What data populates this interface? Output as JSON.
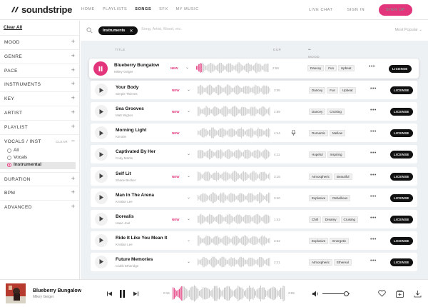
{
  "brand": {
    "name": "soundstripe",
    "accent": "#e2357b"
  },
  "nav": {
    "items": [
      {
        "label": "HOME",
        "active": false
      },
      {
        "label": "PLAYLISTS",
        "active": false
      },
      {
        "label": "SONGS",
        "active": true
      },
      {
        "label": "SFX",
        "active": false
      },
      {
        "label": "MY MUSIC",
        "active": false
      }
    ],
    "live_chat": "LIVE CHAT",
    "sign_in": "SIGN IN",
    "sign_up": "SIGN UP"
  },
  "sidebar": {
    "clear_all": "Clear All",
    "filters_top": [
      "MOOD",
      "GENRE",
      "PACE",
      "INSTRUMENTS",
      "KEY",
      "ARTIST",
      "PLAYLIST"
    ],
    "vocals": {
      "label": "VOCALS / INST",
      "clear": "CLEAR",
      "options": [
        {
          "label": "All",
          "selected": false
        },
        {
          "label": "Vocals",
          "selected": false
        },
        {
          "label": "Instrumental",
          "selected": true
        }
      ]
    },
    "filters_bottom": [
      "DURATION",
      "BPM",
      "ADVANCED"
    ]
  },
  "search": {
    "chip": "Instruments",
    "placeholder": "Song, Artist, Mood, etc.",
    "sort": "Most Popular"
  },
  "table_header": {
    "title": "TITLE",
    "dur": "DUR",
    "mood": "MOOD"
  },
  "songs": [
    {
      "title": "Blueberry Bungalow",
      "artist": "Mikey Geiger",
      "new": "NEW",
      "chev": true,
      "duration": "2:59",
      "tags": [
        "Dancey",
        "Fun",
        "Upbeat"
      ],
      "mic": false,
      "playing": true
    },
    {
      "title": "Your Body",
      "artist": "Simple Thieves",
      "new": "NEW",
      "chev": true,
      "duration": "3:06",
      "tags": [
        "Dancey",
        "Fun",
        "Upbeat"
      ],
      "mic": false,
      "playing": false
    },
    {
      "title": "Sea Grooves",
      "artist": "Matt Wigton",
      "new": "NEW",
      "chev": true,
      "duration": "2:59",
      "tags": [
        "Dancey",
        "Cruising"
      ],
      "mic": false,
      "playing": false
    },
    {
      "title": "Morning Light",
      "artist": "Kimotie",
      "new": "NEW",
      "chev": false,
      "duration": "4:44",
      "tags": [
        "Romantic",
        "Mellow"
      ],
      "mic": true,
      "playing": false
    },
    {
      "title": "Captivated By Her",
      "artist": "Cody Martin",
      "new": "",
      "chev": true,
      "duration": "4:11",
      "tags": [
        "Hopeful",
        "Inspiring"
      ],
      "mic": false,
      "playing": false
    },
    {
      "title": "Self Lit",
      "artist": "Shane Becker",
      "new": "NEW",
      "chev": true,
      "duration": "3:15",
      "tags": [
        "Atmospheric",
        "Beautiful"
      ],
      "mic": false,
      "playing": false
    },
    {
      "title": "Man In The Arena",
      "artist": "Kristian Lee",
      "new": "",
      "chev": true,
      "duration": "3:40",
      "tags": [
        "Explosive",
        "Rebellious"
      ],
      "mic": false,
      "playing": false
    },
    {
      "title": "Borealis",
      "artist": "Isaac Joel",
      "new": "NEW",
      "chev": true,
      "duration": "1:43",
      "tags": [
        "Chill",
        "Dreamy",
        "Cruising"
      ],
      "mic": false,
      "playing": false
    },
    {
      "title": "Ride It Like You Mean It",
      "artist": "Kristian Lee",
      "new": "",
      "chev": true,
      "duration": "3:22",
      "tags": [
        "Explosive",
        "Energetic"
      ],
      "mic": false,
      "playing": false
    },
    {
      "title": "Future Memories",
      "artist": "Caleb Etheridge",
      "new": "",
      "chev": true,
      "duration": "2:21",
      "tags": [
        "Atmospheric",
        "Ethereal"
      ],
      "mic": false,
      "playing": false
    }
  ],
  "license_label": "LICENSE",
  "player": {
    "title": "Blueberry Bungalow",
    "artist": "Mikey Geiger",
    "elapsed": "0:16",
    "total": "2:59",
    "progress": 0.09,
    "volume": 0.88
  }
}
